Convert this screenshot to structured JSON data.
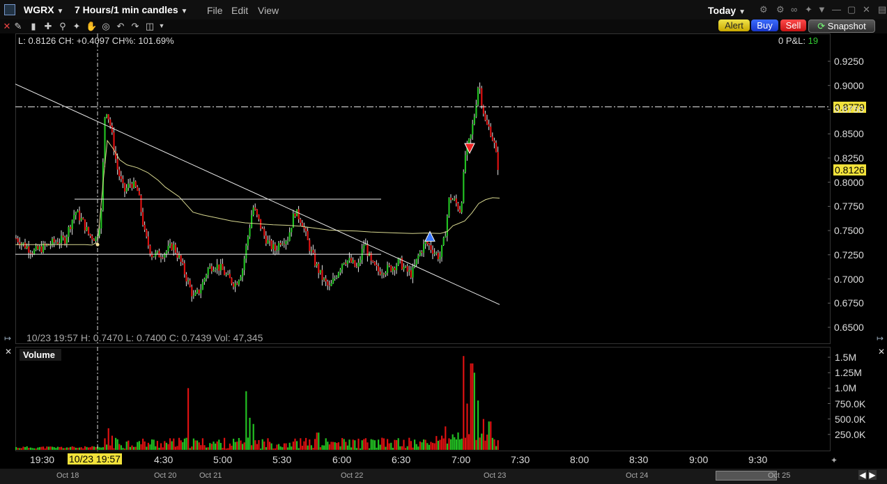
{
  "window": {
    "symbol": "WGRX",
    "period": "7 Hours/1 min candles",
    "menus": [
      "File",
      "Edit",
      "View"
    ],
    "range": "Today"
  },
  "toolbar": {
    "icons": [
      "draw-icon",
      "bars-icon",
      "crosshair-icon",
      "zoom-icon",
      "pan-icon",
      "hand-icon",
      "target-icon",
      "undo-icon",
      "redo-icon",
      "layout-icon",
      "dropdown-icon"
    ],
    "alert_label": "Alert",
    "buy_label": "Buy",
    "sell_label": "Sell",
    "snapshot_label": "Snapshot"
  },
  "header": {
    "price_info": "L: 0.8126 CH: +0.4097 CH%: 101.69%",
    "pnl_label": "0 P&L:",
    "pnl_value": "19"
  },
  "crosshair": {
    "ohlc": "10/23 19:57   H: 0.7470   L: 0.7400   C: 0.7439   Vol: 47,345",
    "time_tag": "10/23 19:57"
  },
  "price_axis": {
    "ticks": [
      "0.9250",
      "0.9000",
      "0.8750",
      "0.8500",
      "0.8250",
      "0.8000",
      "0.7750",
      "0.7500",
      "0.7250",
      "0.7000",
      "0.6750",
      "0.6500"
    ],
    "hline_tag": "0.8779",
    "last_tag": "0.8126"
  },
  "volume_panel": {
    "label": "Volume",
    "ticks": [
      "1.5M",
      "1.25M",
      "1.0M",
      "750.0K",
      "500.0K",
      "250.0K"
    ]
  },
  "time_axis": {
    "labels": [
      "19:30",
      "4:30",
      "5:00",
      "5:30",
      "6:00",
      "6:30",
      "7:00",
      "7:30",
      "8:00",
      "8:30",
      "9:00",
      "9:30"
    ]
  },
  "date_strip": {
    "labels": [
      "Oct 18",
      "Oct 20",
      "Oct 21",
      "Oct 22",
      "Oct 23",
      "Oct 24",
      "Oct 25"
    ]
  },
  "colors": {
    "up": "#22c022",
    "down": "#dd1111",
    "vwap": "#d8d890",
    "axis_tag": "#f2e23a",
    "background": "#000000"
  },
  "chart_data": {
    "type": "candlestick",
    "ylim": [
      0.645,
      0.9525
    ],
    "keypoints": [
      [
        0,
        0.742
      ],
      [
        12,
        0.735
      ],
      [
        25,
        0.728
      ],
      [
        40,
        0.733
      ],
      [
        55,
        0.738
      ],
      [
        70,
        0.741
      ],
      [
        85,
        0.77
      ],
      [
        95,
        0.76
      ],
      [
        105,
        0.745
      ],
      [
        115,
        0.742
      ],
      [
        122,
        0.765
      ],
      [
        128,
        0.88
      ],
      [
        135,
        0.86
      ],
      [
        145,
        0.815
      ],
      [
        155,
        0.79
      ],
      [
        165,
        0.8
      ],
      [
        175,
        0.79
      ],
      [
        185,
        0.745
      ],
      [
        195,
        0.725
      ],
      [
        205,
        0.725
      ],
      [
        215,
        0.728
      ],
      [
        225,
        0.735
      ],
      [
        235,
        0.72
      ],
      [
        245,
        0.7
      ],
      [
        255,
        0.68
      ],
      [
        265,
        0.69
      ],
      [
        275,
        0.71
      ],
      [
        285,
        0.715
      ],
      [
        295,
        0.71
      ],
      [
        305,
        0.7
      ],
      [
        315,
        0.695
      ],
      [
        325,
        0.71
      ],
      [
        333,
        0.745
      ],
      [
        340,
        0.775
      ],
      [
        348,
        0.76
      ],
      [
        356,
        0.745
      ],
      [
        364,
        0.735
      ],
      [
        372,
        0.73
      ],
      [
        380,
        0.74
      ],
      [
        390,
        0.742
      ],
      [
        400,
        0.77
      ],
      [
        410,
        0.76
      ],
      [
        420,
        0.735
      ],
      [
        430,
        0.715
      ],
      [
        440,
        0.7
      ],
      [
        450,
        0.69
      ],
      [
        460,
        0.705
      ],
      [
        470,
        0.72
      ],
      [
        480,
        0.718
      ],
      [
        490,
        0.71
      ],
      [
        500,
        0.738
      ],
      [
        510,
        0.715
      ],
      [
        520,
        0.708
      ],
      [
        530,
        0.71
      ],
      [
        540,
        0.712
      ],
      [
        550,
        0.718
      ],
      [
        560,
        0.708
      ],
      [
        568,
        0.705
      ],
      [
        578,
        0.725
      ],
      [
        588,
        0.738
      ],
      [
        598,
        0.73
      ],
      [
        608,
        0.722
      ],
      [
        615,
        0.742
      ],
      [
        622,
        0.785
      ],
      [
        630,
        0.78
      ],
      [
        638,
        0.77
      ],
      [
        645,
        0.83
      ],
      [
        652,
        0.845
      ],
      [
        658,
        0.87
      ],
      [
        664,
        0.905
      ],
      [
        668,
        0.885
      ],
      [
        674,
        0.86
      ],
      [
        680,
        0.855
      ],
      [
        686,
        0.84
      ],
      [
        692,
        0.815
      ]
    ],
    "vwap": [
      [
        0,
        0.7355
      ],
      [
        10,
        0.7355
      ],
      [
        20,
        0.7355
      ],
      [
        40,
        0.7355
      ],
      [
        60,
        0.7355
      ],
      [
        80,
        0.7355
      ],
      [
        100,
        0.7355
      ],
      [
        110,
        0.735
      ],
      [
        115,
        0.737
      ],
      [
        118,
        0.737
      ],
      [
        126,
        0.8
      ],
      [
        132,
        0.843
      ],
      [
        140,
        0.835
      ],
      [
        150,
        0.823
      ],
      [
        160,
        0.818
      ],
      [
        175,
        0.815
      ],
      [
        190,
        0.81
      ],
      [
        205,
        0.802
      ],
      [
        215,
        0.795
      ],
      [
        225,
        0.79
      ],
      [
        235,
        0.785
      ],
      [
        245,
        0.777
      ],
      [
        255,
        0.769
      ],
      [
        270,
        0.766
      ],
      [
        290,
        0.763
      ],
      [
        310,
        0.76
      ],
      [
        330,
        0.758
      ],
      [
        350,
        0.757
      ],
      [
        370,
        0.756
      ],
      [
        390,
        0.7555
      ],
      [
        410,
        0.7545
      ],
      [
        430,
        0.7525
      ],
      [
        450,
        0.7505
      ],
      [
        470,
        0.75
      ],
      [
        490,
        0.7495
      ],
      [
        510,
        0.7485
      ],
      [
        530,
        0.748
      ],
      [
        550,
        0.7475
      ],
      [
        570,
        0.747
      ],
      [
        590,
        0.7475
      ],
      [
        610,
        0.747
      ],
      [
        620,
        0.749
      ],
      [
        628,
        0.755
      ],
      [
        635,
        0.757
      ],
      [
        645,
        0.76
      ],
      [
        655,
        0.768
      ],
      [
        665,
        0.778
      ],
      [
        675,
        0.782
      ],
      [
        685,
        0.784
      ],
      [
        695,
        0.7835
      ]
    ],
    "trendline": [
      [
        0,
        0.9015
      ],
      [
        695,
        0.6735
      ]
    ],
    "hlines": [
      {
        "y": 0.7825,
        "x0": 85,
        "x1": 525
      },
      {
        "y": 0.7255,
        "x0": 0,
        "x1": 525
      },
      {
        "y": 0.8779,
        "x0": 0,
        "x1": 1170,
        "style": "dashdot"
      }
    ],
    "markers": [
      {
        "x": 595,
        "y": 0.744,
        "dir": "up"
      },
      {
        "x": 652,
        "y": 0.835,
        "dir": "down"
      }
    ],
    "crosshair_x": 118,
    "vol_spikes": [
      [
        133,
        350000
      ],
      [
        137,
        230000
      ],
      [
        247,
        1000000
      ],
      [
        330,
        950000
      ],
      [
        336,
        520000
      ],
      [
        340,
        420000
      ],
      [
        433,
        280000
      ],
      [
        617,
        380000
      ],
      [
        642,
        1520000
      ],
      [
        648,
        750000
      ],
      [
        654,
        1400000
      ],
      [
        658,
        1250000
      ],
      [
        662,
        800000
      ],
      [
        670,
        500000
      ],
      [
        680,
        460000
      ]
    ]
  }
}
